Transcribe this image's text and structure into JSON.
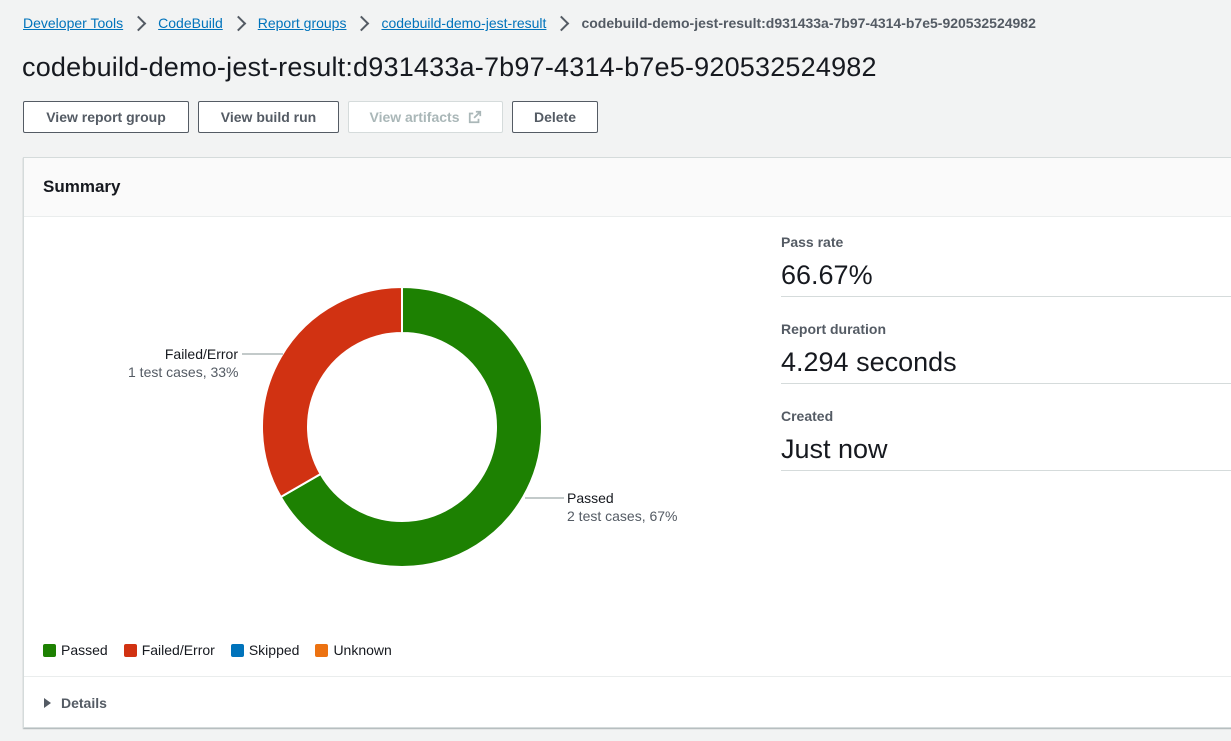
{
  "breadcrumb": {
    "items": [
      "Developer Tools",
      "CodeBuild",
      "Report groups",
      "codebuild-demo-jest-result"
    ],
    "current": "codebuild-demo-jest-result:d931433a-7b97-4314-b7e5-920532524982"
  },
  "page": {
    "title": "codebuild-demo-jest-result:d931433a-7b97-4314-b7e5-920532524982"
  },
  "actions": {
    "view_report_group": "View report group",
    "view_build_run": "View build run",
    "view_artifacts": "View artifacts",
    "delete": "Delete"
  },
  "summary": {
    "title": "Summary",
    "details_label": "Details",
    "metrics": [
      {
        "label": "Pass rate",
        "value": "66.67%"
      },
      {
        "label": "Report duration",
        "value": "4.294 seconds"
      },
      {
        "label": "Created",
        "value": "Just now"
      }
    ]
  },
  "chart_data": {
    "type": "pie",
    "variant": "donut",
    "slices": [
      {
        "name": "Passed",
        "value": 2,
        "percent": 67,
        "detail": "2 test cases, 67%",
        "color": "#1d8102"
      },
      {
        "name": "Failed/Error",
        "value": 1,
        "percent": 33,
        "detail": "1 test cases, 33%",
        "color": "#d13212"
      }
    ],
    "legend": [
      {
        "name": "Passed",
        "color": "#1d8102"
      },
      {
        "name": "Failed/Error",
        "color": "#d13212"
      },
      {
        "name": "Skipped",
        "color": "#0073bb"
      },
      {
        "name": "Unknown",
        "color": "#ec7211"
      }
    ],
    "legend_position": "bottom-left"
  },
  "icons": {
    "breadcrumb_separator": "chevron-right-icon",
    "external_link": "external-link-icon",
    "details_expander": "caret-right-icon"
  }
}
